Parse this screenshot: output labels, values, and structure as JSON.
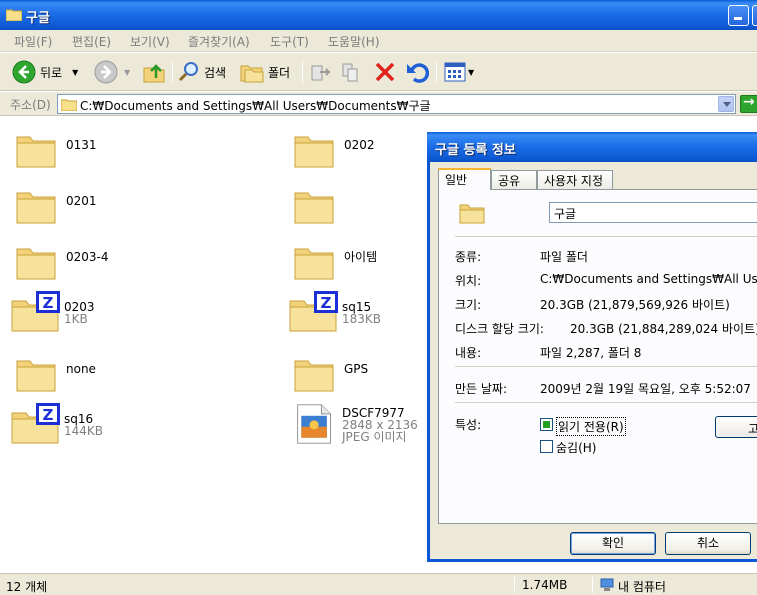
{
  "window": {
    "title": "구글"
  },
  "menu": [
    "파일(F)",
    "편집(E)",
    "보기(V)",
    "즐겨찾기(A)",
    "도구(T)",
    "도움말(H)"
  ],
  "toolbar": {
    "back_label": "뒤로",
    "search_label": "검색",
    "folders_label": "폴더"
  },
  "address": {
    "label": "주소(D)",
    "path": "C:₩Documents and Settings₩All Users₩Documents₩구글"
  },
  "files": [
    {
      "name": "0131",
      "type": "folder"
    },
    {
      "name": "0202",
      "type": "folder"
    },
    {
      "name": "0201",
      "type": "folder"
    },
    {
      "name": "",
      "type": "folder"
    },
    {
      "name": "0203-4",
      "type": "folder"
    },
    {
      "name": "아이템",
      "type": "folder"
    },
    {
      "name": "0203",
      "size": "1KB",
      "type": "zfile"
    },
    {
      "name": "sq15",
      "size": "183KB",
      "type": "zfile"
    },
    {
      "name": "none",
      "type": "folder"
    },
    {
      "name": "GPS",
      "type": "folder"
    },
    {
      "name": "sq16",
      "size": "144KB",
      "type": "zfile"
    },
    {
      "name": "DSCF7977",
      "dims": "2848 x 2136",
      "kind": "JPEG 이미지",
      "type": "image"
    }
  ],
  "status": {
    "count": "12 개체",
    "size": "1.74MB",
    "location": "내 컴퓨터"
  },
  "dialog": {
    "title": "구글 등록 정보",
    "tabs": [
      "일반",
      "공유",
      "사용자 지정"
    ],
    "folder_name": "구글",
    "type_label": "종류:",
    "type_value": "파일 폴더",
    "location_label": "위치:",
    "location_value": "C:₩Documents and Settings₩All Users",
    "size_label": "크기:",
    "size_value": "20.3GB (21,879,569,926 바이트)",
    "disk_label": "디스크 할당 크기:",
    "disk_value": "20.3GB (21,884,289,024 바이트)",
    "contents_label": "내용:",
    "contents_value": "파일 2,287, 폴더 8",
    "created_label": "만든 날짜:",
    "created_value": "2009년 2월 19일 목요일, 오후 5:52:07",
    "attributes_label": "특성:",
    "readonly_label": "읽기 전용(R)",
    "readonly_checked": true,
    "hidden_label": "숨김(H)",
    "hidden_checked": false,
    "advanced_label": "고급",
    "ok_label": "확인",
    "cancel_label": "취소"
  },
  "colors": {
    "titlebar": "#0a5fd8",
    "folder": "#f2d27a",
    "zbadge": "#1a2fd6"
  }
}
